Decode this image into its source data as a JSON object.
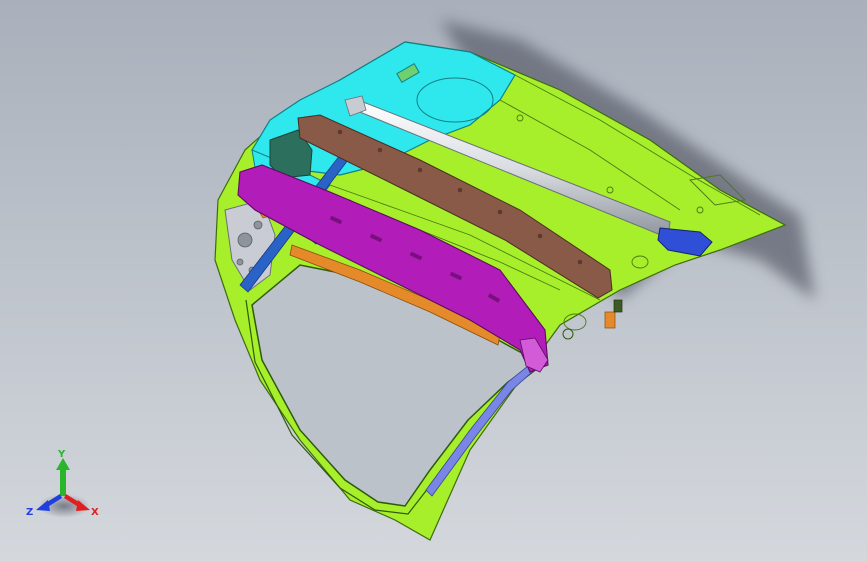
{
  "viewport": {
    "background_top": "#a9b0bb",
    "background_bottom": "#d4d8dd"
  },
  "model": {
    "panel_colors": {
      "inner_panel": "#a6ef2a",
      "upper_panel": "#2ee8ee",
      "rear_beam": "#8a5a48",
      "front_beam": "#b21cb8",
      "hinge_rod": "#d9dde2",
      "end_bracket": "#2f4fd6",
      "side_bracket": "#2a63c6",
      "edge_strip": "#7a86e6",
      "latch_strip": "#e58a2a",
      "left_plate": "#c9cdd3",
      "mount_block": "#2c6f5c"
    }
  },
  "triad": {
    "axes": [
      {
        "label": "Y",
        "color": "#2bb52b",
        "icon": "y-axis-arrow-icon"
      },
      {
        "label": "X",
        "color": "#e02020",
        "icon": "x-axis-arrow-icon"
      },
      {
        "label": "Z",
        "color": "#1f3fe0",
        "icon": "z-axis-arrow-icon"
      }
    ]
  }
}
